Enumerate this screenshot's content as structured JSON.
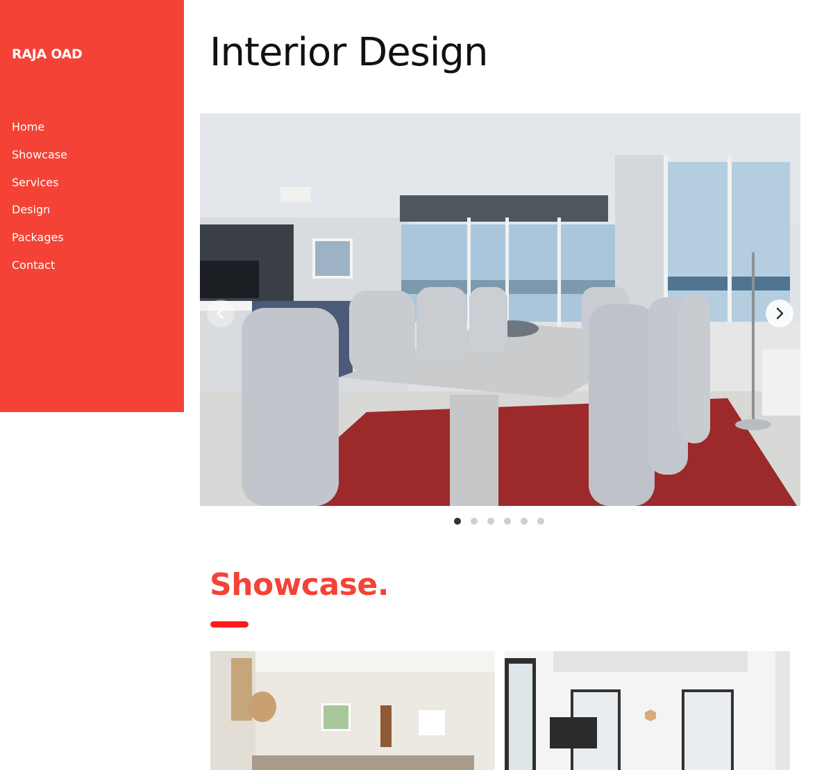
{
  "sidebar": {
    "brand": "RAJA OAD",
    "items": [
      {
        "label": "Home"
      },
      {
        "label": "Showcase"
      },
      {
        "label": "Services"
      },
      {
        "label": "Design"
      },
      {
        "label": "Packages"
      },
      {
        "label": "Contact"
      }
    ]
  },
  "main": {
    "title": "Interior Design",
    "carousel": {
      "current_slide": 1,
      "total_slides": 6,
      "prev_icon": "chevron-left-icon",
      "next_icon": "chevron-right-icon"
    },
    "showcase": {
      "title": "Showcase."
    }
  },
  "colors": {
    "accent": "#f44336",
    "section_bar": "#ff1a1a",
    "text": "#111111"
  }
}
